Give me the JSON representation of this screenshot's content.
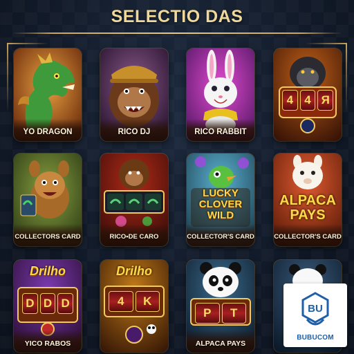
{
  "header": {
    "title": "SELECTIO DAS"
  },
  "games": [
    {
      "label": "YO DRAGON",
      "icon": "dragon-icon"
    },
    {
      "label": "RICO DJ",
      "icon": "gorilla-dj-icon"
    },
    {
      "label": "RICO RABBIT",
      "icon": "rabbit-icon"
    },
    {
      "label": "",
      "icon": "gorilla-slot-icon",
      "reels": [
        "4",
        "Я"
      ]
    },
    {
      "label": "COLLECTORS CARD",
      "icon": "squirrel-slot-icon"
    },
    {
      "label": "RICO•DE CARO",
      "icon": "gorilla-reels-icon"
    },
    {
      "label": "COLLECTOR'S CARD",
      "icon": "lucky-clover-bird-icon",
      "banner": [
        "LUCKY",
        "CLOVER",
        "WILD"
      ]
    },
    {
      "label": "COLLECTOR'S CARD",
      "icon": "alpaca-icon",
      "banner": [
        "ALPACA",
        "PAYS"
      ]
    },
    {
      "label": "YICO RABOS",
      "icon": "slot-machine-icon",
      "banner": [
        "Drilho"
      ],
      "reels": [
        "D",
        "D"
      ]
    },
    {
      "label": "",
      "icon": "slot-machine-panda-icon",
      "banner": [
        "Drilho"
      ],
      "reels": [
        "4",
        "K"
      ]
    },
    {
      "label": "ALPACA PAYS",
      "icon": "panda-icon",
      "reels": [
        "P",
        "T"
      ]
    },
    {
      "label": "",
      "icon": "panda-partial-icon"
    }
  ],
  "watermark": {
    "text": "BUBUCOM",
    "monogram": "BU"
  }
}
